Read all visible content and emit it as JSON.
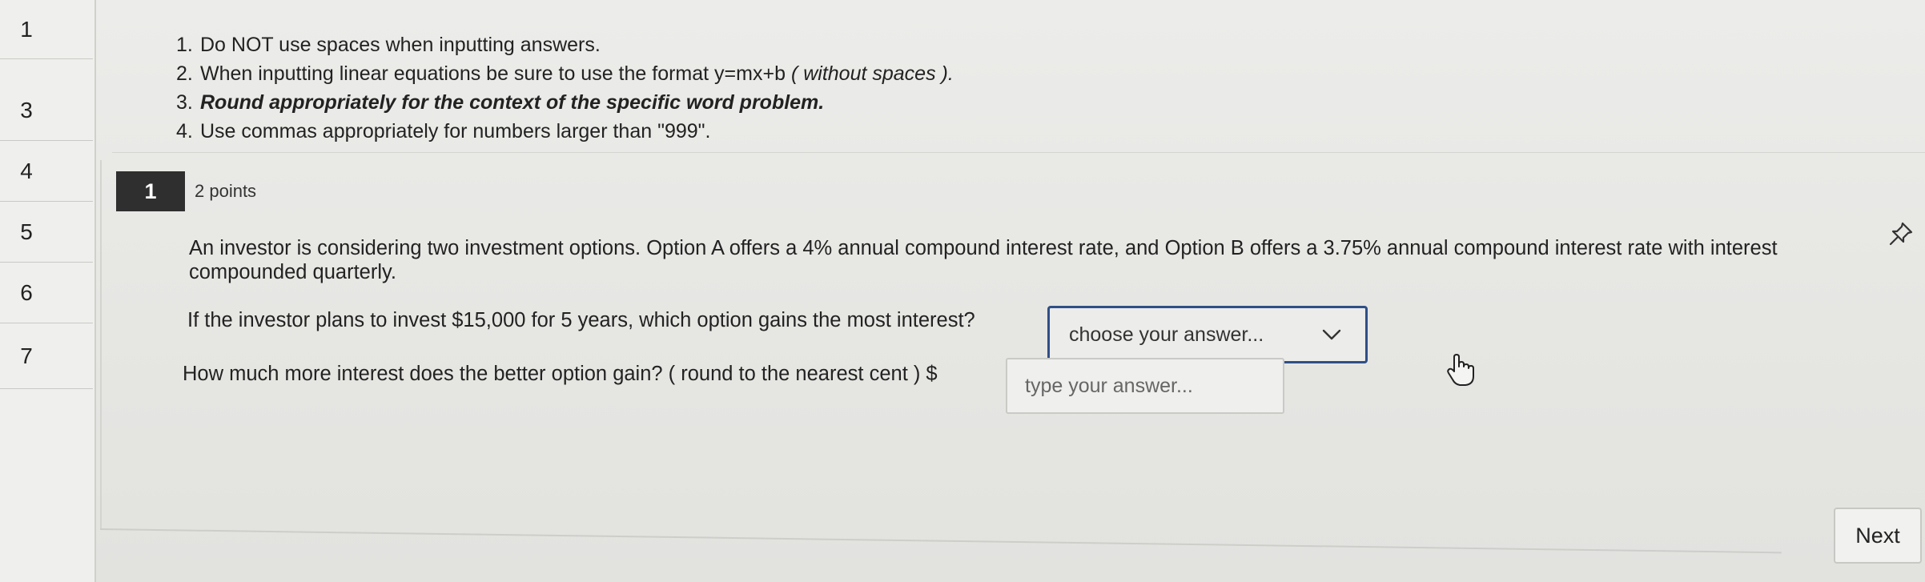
{
  "question_nav": {
    "items": [
      "1",
      "3",
      "4",
      "5",
      "6",
      "7"
    ]
  },
  "instructions": [
    {
      "num": "1.",
      "text": "Do NOT use spaces when inputting answers."
    },
    {
      "num": "2.",
      "text": "When inputting linear equations be sure to use the format y=mx+b",
      "italic_text": "( without spaces )."
    },
    {
      "num": "3.",
      "bold_italic_text": "Round appropriately for the context of the specific word problem."
    },
    {
      "num": "4.",
      "text": "Use commas appropriately for numbers larger than \"999\"."
    }
  ],
  "question": {
    "number": "1",
    "points": "2 points",
    "text": "An investor is considering two investment options. Option A offers a 4% annual compound interest rate, and Option B offers a 3.75% annual compound interest rate with interest compounded quarterly.",
    "part1_prompt": "If the investor plans to invest $15,000 for 5 years, which option gains the most interest?",
    "part1_select_value": "choose your answer...",
    "part2_prompt": "How much more interest does the better option gain? ( round to the nearest cent ) $",
    "part2_placeholder": "type your answer..."
  },
  "footer": {
    "next_label": "Next"
  },
  "icons": {
    "pin": "pin-icon",
    "chevron": "chevron-down-icon",
    "cursor": "hand-pointer-icon"
  },
  "colors": {
    "select_border": "#2f4f86",
    "question_badge": "#2f2f2f"
  }
}
